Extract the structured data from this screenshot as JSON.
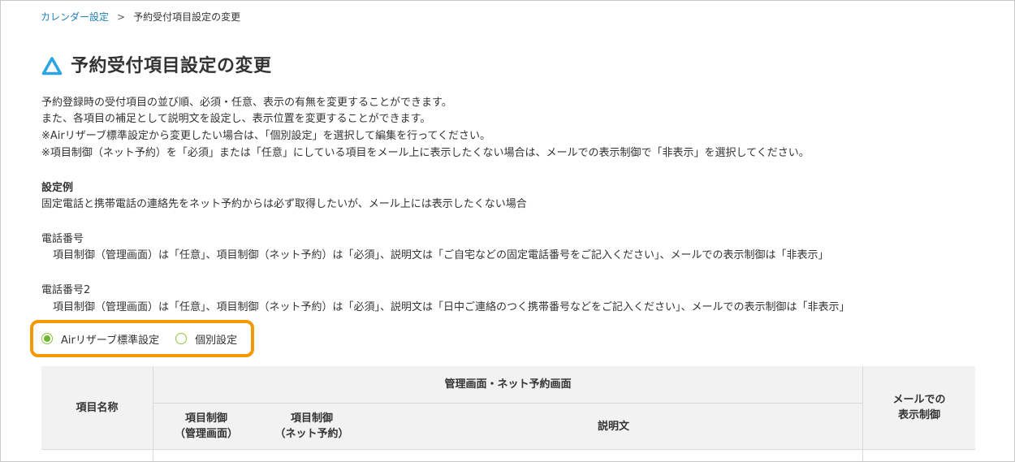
{
  "breadcrumb": {
    "parent": "カレンダー設定",
    "separator": ">",
    "current": "予約受付項目設定の変更"
  },
  "page": {
    "title": "予約受付項目設定の変更",
    "icon": "triangle-icon",
    "accent_color": "#2ca6e0"
  },
  "description": {
    "line1": "予約登録時の受付項目の並び順、必須・任意、表示の有無を変更することができます。",
    "line2": "また、各項目の補足として説明文を設定し、表示位置を変更することができます。",
    "line3": "※Airリザーブ標準設定から変更したい場合は、「個別設定」を選択して編集を行ってください。",
    "line4": "※項目制御（ネット予約）を「必須」または「任意」にしている項目をメール上に表示したくない場合は、メールでの表示制御で「非表示」を選択してください。"
  },
  "example": {
    "heading": "設定例",
    "intro": "固定電話と携帯電話の連絡先をネット予約からは必ず取得したいが、メール上には表示したくない場合",
    "phone1_label": "電話番号",
    "phone1_detail": "項目制御（管理画面）は「任意」、項目制御（ネット予約）は「必須」、説明文は「ご自宅などの固定電話番号をご記入ください」、メールでの表示制御は「非表示」",
    "phone2_label": "電話番号2",
    "phone2_detail": "項目制御（管理画面）は「任意」、項目制御（ネット予約）は「必須」、説明文は「日中ご連絡のつく携帯番号などをご記入ください」、メールでの表示制御は「非表示」"
  },
  "settings_mode": {
    "options": [
      "Airリザーブ標準設定",
      "個別設定"
    ],
    "selected": "Airリザーブ標準設定",
    "highlight_color": "#f39800",
    "radio_color": "#6eb52f"
  },
  "table": {
    "col_item_name": "項目名称",
    "group_header": "管理画面・ネット予約画面",
    "col_control_admin_line1": "項目制御",
    "col_control_admin_line2": "（管理画面）",
    "col_control_net_line1": "項目制御",
    "col_control_net_line2": "（ネット予約）",
    "col_description": "説明文",
    "col_mail_line1": "メールでの",
    "col_mail_line2": "表示制御"
  }
}
